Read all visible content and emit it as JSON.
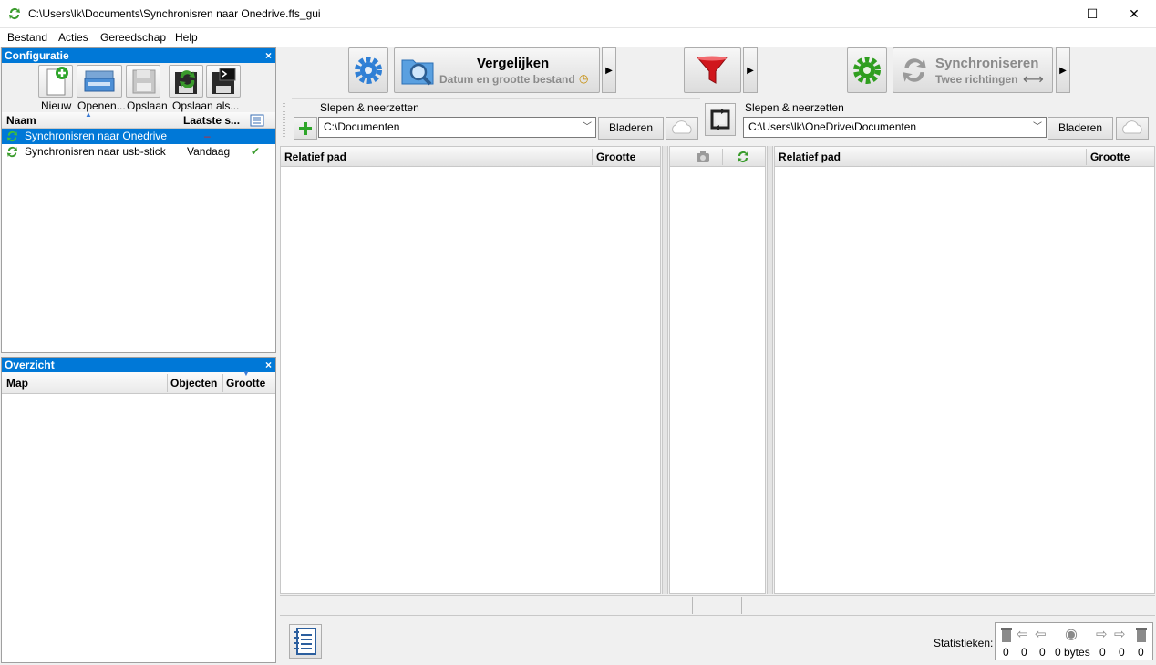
{
  "window": {
    "title": "C:\\Users\\lk\\Documents\\Synchronisren naar Onedrive.ffs_gui",
    "minimize_glyph": "—",
    "maximize_glyph": "☐",
    "close_glyph": "✕"
  },
  "menu": [
    "Bestand",
    "Acties",
    "Gereedschap",
    "Help"
  ],
  "config_pane": {
    "title": "Configuratie",
    "close": "×",
    "toolbar": [
      {
        "label": "Nieuw",
        "icon": "new-config-icon"
      },
      {
        "label": "Openen...",
        "icon": "open-config-icon"
      },
      {
        "label": "Opslaan",
        "icon": "save-config-icon"
      },
      {
        "label": "Opslaan als...",
        "icon": "save-as-config-icon"
      },
      {
        "label": "",
        "icon": "save-as-batch-icon"
      }
    ],
    "columns": {
      "name": "Naam",
      "last_sync": "Laatste s..."
    },
    "rows": [
      {
        "name": "Synchronisren naar Onedrive",
        "last_sync": "–",
        "selected": true,
        "status": ""
      },
      {
        "name": "Synchronisren naar usb-stick",
        "last_sync": "Vandaag",
        "selected": false,
        "status": "✔"
      }
    ]
  },
  "overview_pane": {
    "title": "Overzicht",
    "close": "×",
    "columns": {
      "map": "Map",
      "objects": "Objecten",
      "size": "Grootte"
    }
  },
  "main_toolbar": {
    "compare": {
      "label": "Vergelijken",
      "sub": "Datum en grootte bestand",
      "icon": "compare-magnifier-icon"
    },
    "filter": {
      "icon": "filter-funnel-icon"
    },
    "sync": {
      "label": "Synchroniseren",
      "sub": "Twee richtingen",
      "sub_glyph": "⟷",
      "icon": "sync-arrows-icon"
    },
    "dropdown_glyph": "▶"
  },
  "left_folder": {
    "label": "Slepen & neerzetten",
    "path": "C:\\Documenten",
    "browse": "Bladeren"
  },
  "right_folder": {
    "label": "Slepen & neerzetten",
    "path": "C:\\Users\\lk\\OneDrive\\Documenten",
    "browse": "Bladeren"
  },
  "grid": {
    "left": {
      "path": "Relatief pad",
      "size": "Grootte"
    },
    "right": {
      "path": "Relatief pad",
      "size": "Grootte"
    }
  },
  "stats": {
    "label": "Statistieken:",
    "values": [
      "0",
      "0",
      "0",
      "0 bytes",
      "0",
      "0",
      "0"
    ]
  },
  "colors": {
    "accent": "#0078d7",
    "sync_green": "#3a9b2c",
    "filter_red": "#d0161c",
    "gear_blue": "#2f7fd5",
    "gear_green": "#2f9e1f"
  }
}
